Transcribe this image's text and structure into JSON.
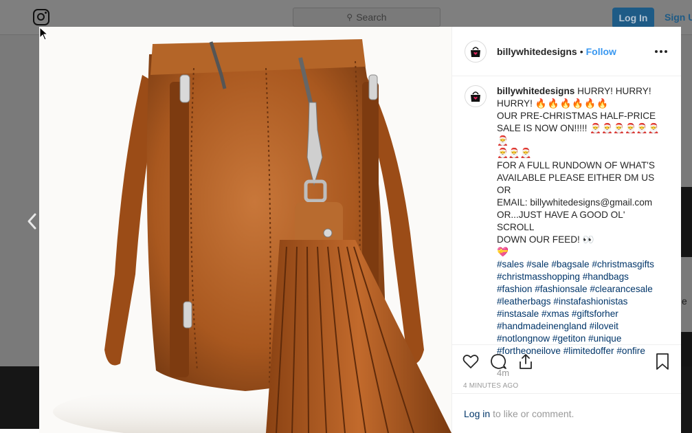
{
  "background": {
    "search_placeholder": "Search",
    "login_label": "Log In",
    "signup_label": "Sign U"
  },
  "post": {
    "username": "billywhitedesigns",
    "separator": "•",
    "follow_label": "Follow",
    "caption": {
      "username": "billywhitedesigns",
      "line1": "HURRY! HURRY!",
      "line2_text": "HURRY!",
      "line2_emoji": "🔥🔥🔥🔥🔥🔥",
      "line3": "OUR PRE-CHRISTMAS HALF-PRICE",
      "line4_text": "SALE IS NOW ON!!!!!",
      "line4_emoji": "🎅🎅🎅🎅🎅🎅🎅",
      "line5_emoji": "🎅🎅🎅",
      "line6": "FOR A FULL RUNDOWN OF WHAT'S",
      "line7": "AVAILABLE PLEASE EITHER DM US OR",
      "line8": "EMAIL: billywhitedesigns@gmail.com",
      "line9": "OR...JUST HAVE A GOOD OL' SCROLL",
      "line10": "DOWN OUR FEED! 👀",
      "line11_emoji": "💝",
      "hashtags": [
        "#sales",
        "#sale",
        "#bagsale",
        "#christmasgifts",
        "#christmasshopping",
        "#handbags",
        "#fashion",
        "#fashionsale",
        "#clearancesale",
        "#leatherbags",
        "#instafashionistas",
        "#instasale",
        "#xmas",
        "#giftsforher",
        "#handmadeinengland",
        "#iloveit",
        "#notlongnow",
        "#getiton",
        "#unique",
        "#fortheoneilove",
        "#limitedoffer",
        "#onfire"
      ],
      "relative_time": "4m"
    },
    "timestamp": "4 MINUTES AGO",
    "login_link": "Log in",
    "login_suffix": "to like or comment."
  },
  "icons": [
    "instagram-icon",
    "search-icon",
    "chevron-left-icon",
    "more-icon",
    "heart-icon",
    "comment-icon",
    "share-icon",
    "bookmark-icon",
    "avatar-bag-icon",
    "cursor-icon"
  ]
}
